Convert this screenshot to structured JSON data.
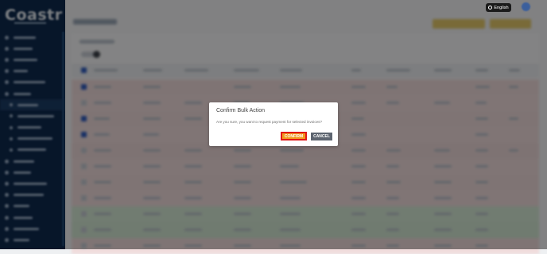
{
  "header": {
    "language": "English",
    "globe_icon": "globe-icon"
  },
  "modal": {
    "title": "Confirm Bulk Action",
    "message": "Are you sure, you want to request payment for selected invoices?",
    "confirm_label": "CONFIRM",
    "cancel_label": "CANCEL"
  },
  "colors": {
    "sidebar": "#0e2a4e",
    "confirm_button": "#f29a1e",
    "confirm_outline": "#e11717",
    "cancel_button": "#5d6570",
    "language_pill": "#1b1b1b"
  }
}
